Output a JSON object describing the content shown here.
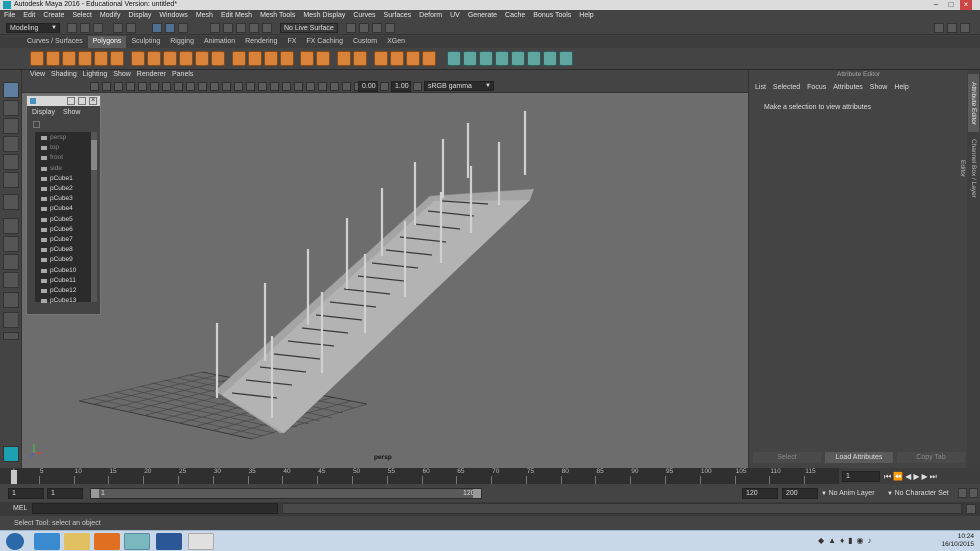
{
  "window": {
    "title": "Autodesk Maya 2016 - Educational Version: untitled*"
  },
  "menubar": [
    "File",
    "Edit",
    "Create",
    "Select",
    "Modify",
    "Display",
    "Windows",
    "Mesh",
    "Edit Mesh",
    "Mesh Tools",
    "Mesh Display",
    "Curves",
    "Surfaces",
    "Deform",
    "UV",
    "Generate",
    "Cache",
    "Bonus Tools",
    "Help"
  ],
  "status": {
    "mode": "Modeling",
    "live_surface": "No Live Surface"
  },
  "shelf_tabs": [
    {
      "label": "Curves / Surfaces",
      "active": false
    },
    {
      "label": "Polygons",
      "active": true
    },
    {
      "label": "Sculpting",
      "active": false
    },
    {
      "label": "Rigging",
      "active": false
    },
    {
      "label": "Animation",
      "active": false
    },
    {
      "label": "Rendering",
      "active": false
    },
    {
      "label": "FX",
      "active": false
    },
    {
      "label": "FX Caching",
      "active": false
    },
    {
      "label": "Custom",
      "active": false
    },
    {
      "label": "XGen",
      "active": false
    }
  ],
  "viewport": {
    "menu": [
      "View",
      "Shading",
      "Lighting",
      "Show",
      "Renderer",
      "Panels"
    ],
    "exposure": "0.00",
    "gamma": "1.00",
    "color_space": "sRGB gamma",
    "camera_label": "persp"
  },
  "outliner": {
    "menu": [
      "Display",
      "Show"
    ],
    "items": [
      {
        "label": "persp",
        "dim": true
      },
      {
        "label": "top",
        "dim": true
      },
      {
        "label": "front",
        "dim": true
      },
      {
        "label": "side",
        "dim": true
      },
      {
        "label": "pCube1",
        "dim": false
      },
      {
        "label": "pCube2",
        "dim": false
      },
      {
        "label": "pCube3",
        "dim": false
      },
      {
        "label": "pCube4",
        "dim": false
      },
      {
        "label": "pCube5",
        "dim": false
      },
      {
        "label": "pCube6",
        "dim": false
      },
      {
        "label": "pCube7",
        "dim": false
      },
      {
        "label": "pCube8",
        "dim": false
      },
      {
        "label": "pCube9",
        "dim": false
      },
      {
        "label": "pCube10",
        "dim": false
      },
      {
        "label": "pCube11",
        "dim": false
      },
      {
        "label": "pCube12",
        "dim": false
      },
      {
        "label": "pCube13",
        "dim": false
      }
    ]
  },
  "attribute_editor": {
    "title": "Attribute Editor",
    "menu": [
      "List",
      "Selected",
      "Focus",
      "Attributes",
      "Show",
      "Help"
    ],
    "message": "Make a selection to view attributes",
    "buttons": {
      "select": "Select",
      "load": "Load Attributes",
      "copy": "Copy Tab"
    },
    "side_tabs": [
      "Attribute Editor",
      "Channel Box / Layer Editor"
    ]
  },
  "timeline": {
    "ticks": [
      "1",
      "5",
      "10",
      "15",
      "20",
      "25",
      "30",
      "35",
      "40",
      "45",
      "50",
      "55",
      "60",
      "65",
      "70",
      "75",
      "80",
      "85",
      "90",
      "95",
      "100",
      "105",
      "110",
      "115",
      "120"
    ],
    "current_frame": "1"
  },
  "range": {
    "start": "1",
    "start2": "1",
    "slider_start": "1",
    "slider_end": "120",
    "end": "120",
    "end2": "200",
    "anim_layer": "No Anim Layer",
    "character_set": "No Character Set"
  },
  "command": {
    "label": "MEL"
  },
  "help_line": "Select Tool: select an object",
  "taskbar": {
    "time": "10:24",
    "date": "16/10/2015"
  }
}
